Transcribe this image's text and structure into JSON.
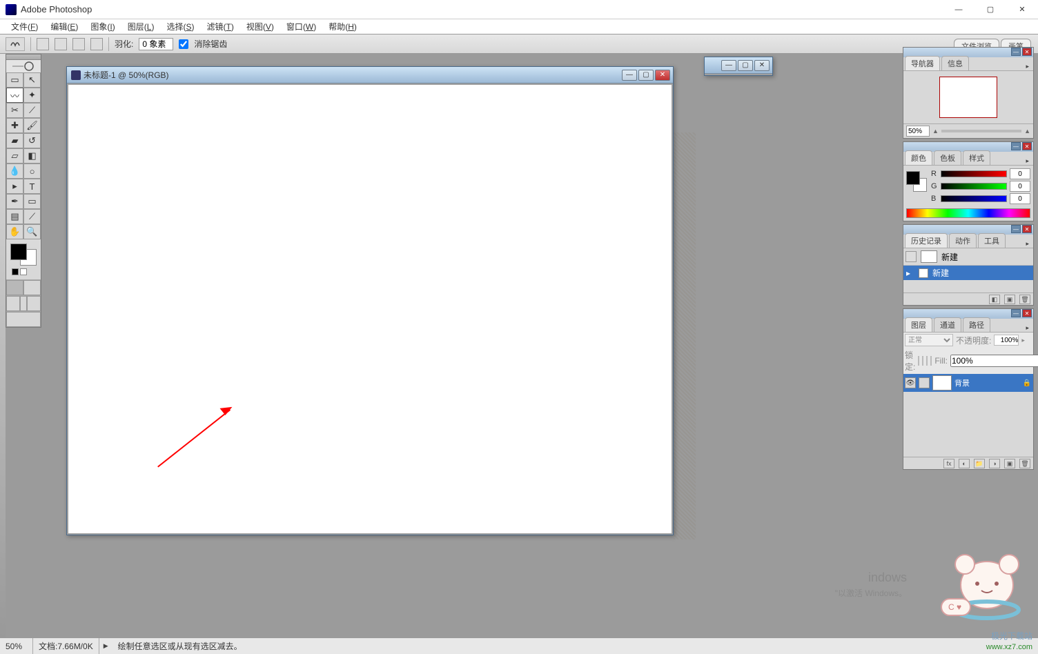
{
  "app": {
    "title": "Adobe Photoshop"
  },
  "menubar": {
    "items": [
      {
        "label": "文件",
        "accel": "F"
      },
      {
        "label": "编辑",
        "accel": "E"
      },
      {
        "label": "图象",
        "accel": "I"
      },
      {
        "label": "图层",
        "accel": "L"
      },
      {
        "label": "选择",
        "accel": "S"
      },
      {
        "label": "滤镜",
        "accel": "T"
      },
      {
        "label": "视图",
        "accel": "V"
      },
      {
        "label": "窗口",
        "accel": "W"
      },
      {
        "label": "帮助",
        "accel": "H"
      }
    ]
  },
  "optionsbar": {
    "feather_label": "羽化:",
    "feather_value": "0 象素",
    "antialias_label": "消除锯齿",
    "antialias_checked": true
  },
  "doc_tabs": {
    "items": [
      "文件浏览",
      "画笔"
    ]
  },
  "document": {
    "front": {
      "title": "未标题-1 @ 50%(RGB)"
    }
  },
  "panels": {
    "navigator": {
      "tabs": [
        "导航器",
        "信息"
      ],
      "zoom": "50%"
    },
    "color": {
      "tabs": [
        "颜色",
        "色板",
        "样式"
      ],
      "r": {
        "label": "R",
        "value": "0"
      },
      "g": {
        "label": "G",
        "value": "0"
      },
      "b": {
        "label": "B",
        "value": "0"
      }
    },
    "history": {
      "tabs": [
        "历史记录",
        "动作",
        "工具"
      ],
      "snapshot": "新建",
      "items": [
        "新建"
      ]
    },
    "layers": {
      "tabs": [
        "图层",
        "通道",
        "路径"
      ],
      "blend_mode": "正常",
      "opacity_label": "不透明度:",
      "opacity_value": "100%",
      "lock_label": "锁定:",
      "fill_label": "Fill:",
      "fill_value": "100%",
      "items": [
        {
          "name": "背景",
          "locked": true
        }
      ]
    }
  },
  "statusbar": {
    "zoom": "50%",
    "doc_info": "文档:7.66M/0K",
    "hint": "绘制任意选区或从现有选区减去。"
  },
  "watermark": {
    "windows": "indows",
    "activate": "\"以激活 Windows。"
  },
  "urls": {
    "cn": "极光下载站",
    "en": "www.xz7.com"
  }
}
